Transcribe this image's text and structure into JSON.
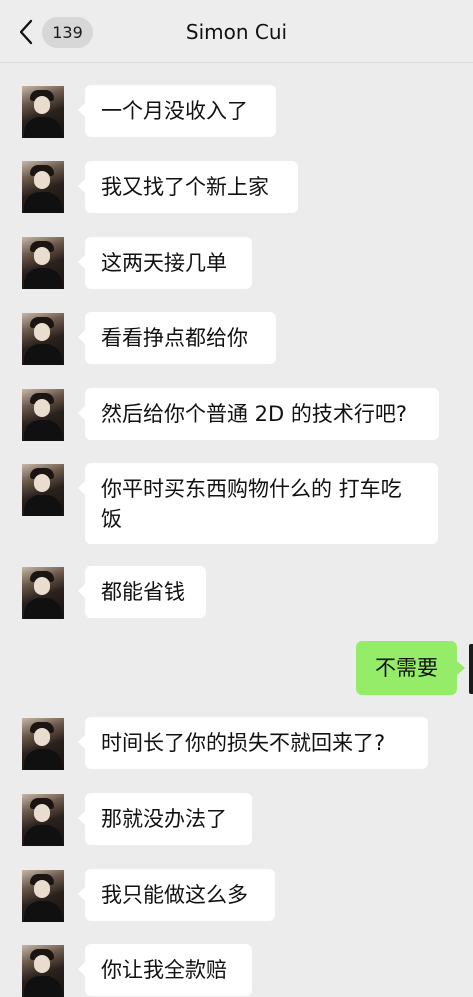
{
  "header": {
    "back_icon": "chevron-left-icon",
    "unread_count": "139",
    "title": "Simon Cui"
  },
  "messages": [
    {
      "side": "left",
      "text": "一个月没收入了"
    },
    {
      "side": "left",
      "text": "我又找了个新上家"
    },
    {
      "side": "left",
      "text": "这两天接几单"
    },
    {
      "side": "left",
      "text": "看看挣点都给你"
    },
    {
      "side": "left",
      "text": "然后给你个普通 2D 的技术行吧?"
    },
    {
      "side": "left",
      "text": "你平时买东西购物什么的 打车吃饭"
    },
    {
      "side": "left",
      "text": "都能省钱"
    },
    {
      "side": "right",
      "text": "不需要"
    },
    {
      "side": "left",
      "text": "时间长了你的损失不就回来了?"
    },
    {
      "side": "left",
      "text": "那就没办法了"
    },
    {
      "side": "left",
      "text": "我只能做这么多"
    },
    {
      "side": "left",
      "text": "你让我全款赔"
    }
  ],
  "colors": {
    "background": "#ececec",
    "received_bubble": "#ffffff",
    "sent_bubble": "#95ec69"
  }
}
